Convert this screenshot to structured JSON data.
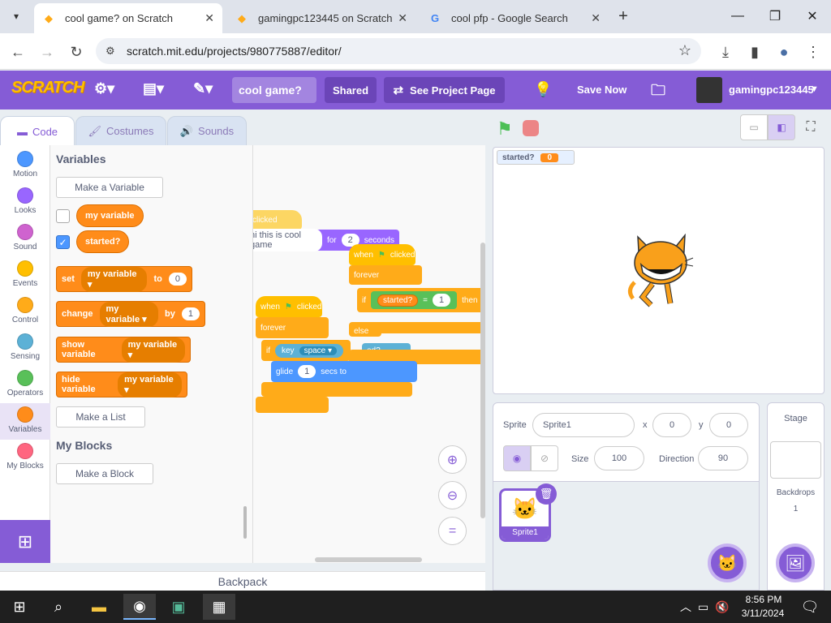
{
  "browser": {
    "tabs": [
      {
        "title": "cool game? on Scratch",
        "active": true
      },
      {
        "title": "gamingpc123445 on Scratch",
        "active": false
      },
      {
        "title": "cool pfp - Google Search",
        "active": false
      }
    ],
    "url": "scratch.mit.edu/projects/980775887/editor/"
  },
  "menubar": {
    "logo": "SCRATCH",
    "project_title": "cool game?",
    "shared_label": "Shared",
    "see_project_label": "See Project Page",
    "save_label": "Save Now",
    "username": "gamingpc123445"
  },
  "editor_tabs": [
    "Code",
    "Costumes",
    "Sounds"
  ],
  "categories": [
    {
      "label": "Motion",
      "color": "#4c97ff"
    },
    {
      "label": "Looks",
      "color": "#9966ff"
    },
    {
      "label": "Sound",
      "color": "#cf63cf"
    },
    {
      "label": "Events",
      "color": "#ffbf00"
    },
    {
      "label": "Control",
      "color": "#ffab19"
    },
    {
      "label": "Sensing",
      "color": "#5cb1d6"
    },
    {
      "label": "Operators",
      "color": "#59c059"
    },
    {
      "label": "Variables",
      "color": "#ff8c1a"
    },
    {
      "label": "My Blocks",
      "color": "#ff6680"
    }
  ],
  "palette": {
    "variables_title": "Variables",
    "make_variable": "Make a Variable",
    "var1": "my variable",
    "var2": "started?",
    "set": {
      "word": "set",
      "var": "my variable",
      "to": "to",
      "value": "0"
    },
    "change": {
      "word": "change",
      "var": "my variable",
      "by": "by",
      "value": "1"
    },
    "show": {
      "word": "show variable",
      "var": "my variable"
    },
    "hide": {
      "word": "hide variable",
      "var": "my variable"
    },
    "make_list": "Make a List",
    "myblocks_title": "My Blocks",
    "make_block": "Make a Block"
  },
  "script": {
    "when": "when",
    "clicked": "clicked",
    "say_text": "hi this is cool game",
    "for_word": "for",
    "say_secs": "2",
    "seconds": "seconds",
    "forever": "forever",
    "if_word": "if",
    "started": "started?",
    "eq": "=",
    "eq_val": "1",
    "then": "then",
    "else_word": "else",
    "key": "key",
    "space": "space",
    "glide": "glide",
    "glide_val": "1",
    "secs_to": "secs to",
    "partial_started": "ed?"
  },
  "backpack": "Backpack",
  "stage": {
    "monitor_label": "started?",
    "monitor_value": "0"
  },
  "sprite_info": {
    "sprite_label": "Sprite",
    "sprite_name": "Sprite1",
    "x_label": "x",
    "x_value": "0",
    "y_label": "y",
    "y_value": "0",
    "size_label": "Size",
    "size_value": "100",
    "direction_label": "Direction",
    "direction_value": "90",
    "thumb_name": "Sprite1"
  },
  "stage_pane": {
    "title": "Stage",
    "backdrops_label": "Backdrops",
    "backdrops_count": "1"
  },
  "taskbar": {
    "time": "8:56 PM",
    "date": "3/11/2024"
  }
}
